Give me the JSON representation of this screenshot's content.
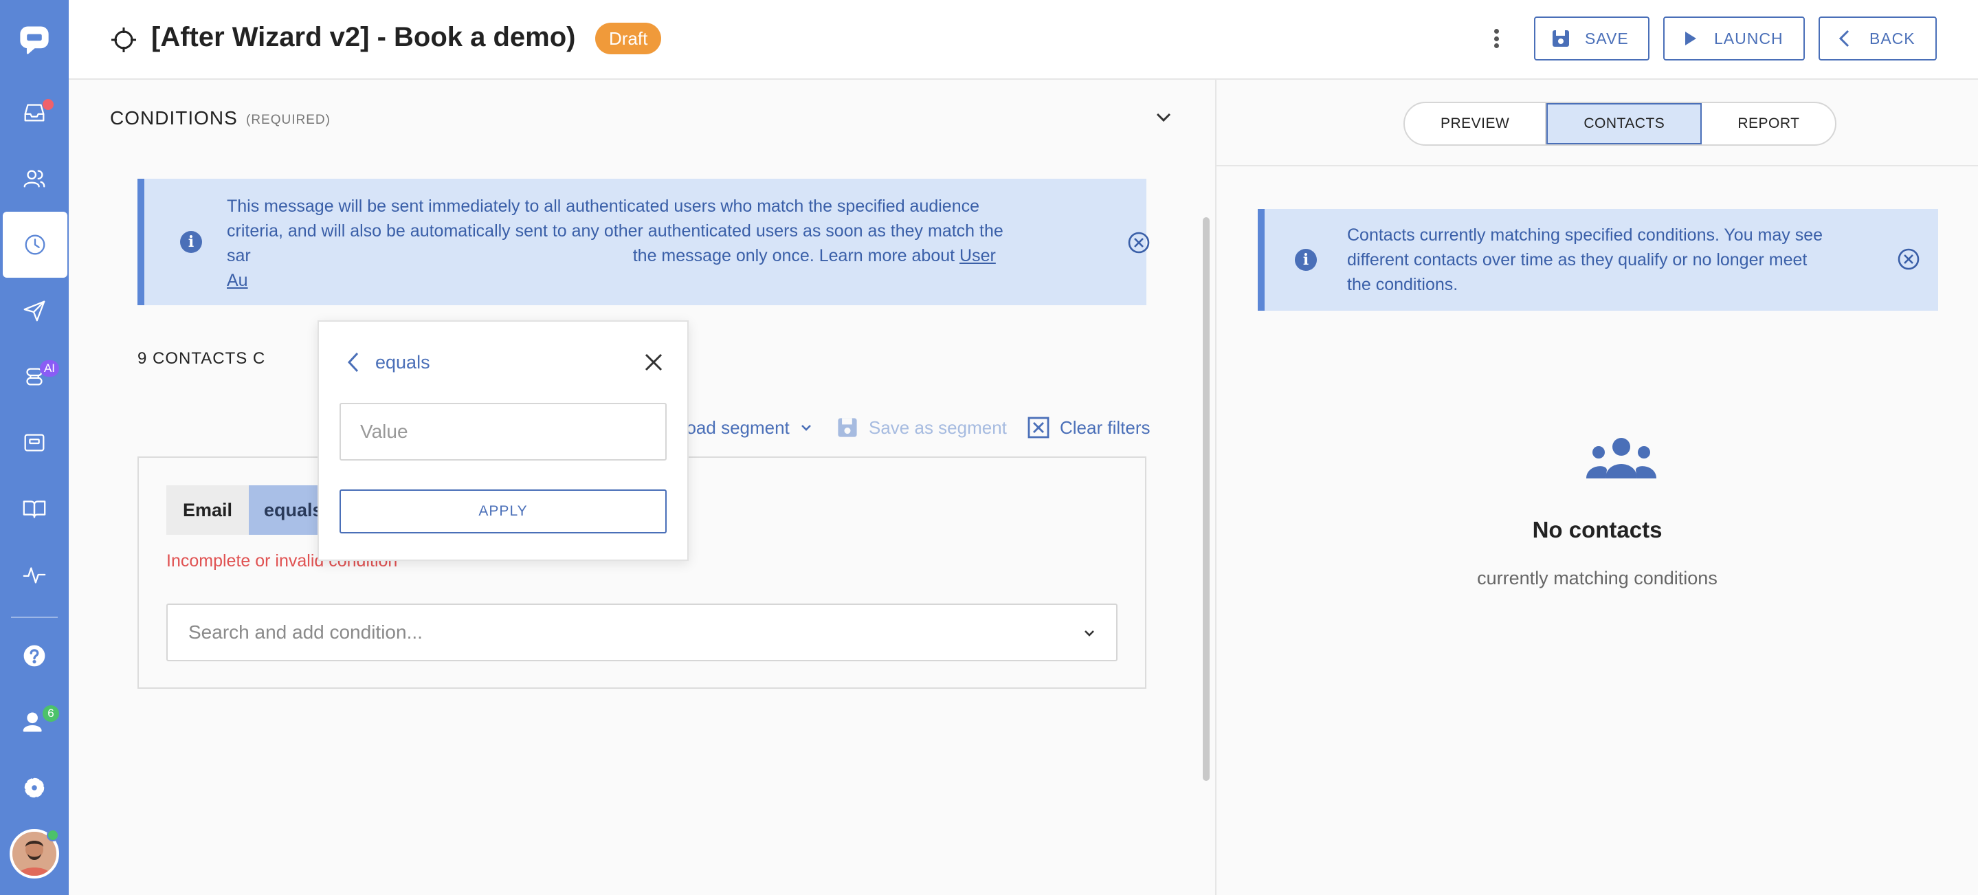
{
  "header": {
    "title": "[After Wizard v2] - Book a demo)",
    "status_badge": "Draft",
    "save_label": "SAVE",
    "launch_label": "LAUNCH",
    "back_label": "BACK"
  },
  "conditions": {
    "title": "CONDITIONS",
    "required": "(REQUIRED)",
    "info_line1": "This message will be sent immediately to all authenticated users who match the specified audience",
    "info_line2": "criteria, and will also be automatically sent to any other authenticated users as soon as they match the",
    "info_line3_start": "sar",
    "info_line3_end": "the message only once. Learn more about ",
    "info_link_1": "User",
    "info_link_2": "Au",
    "contacts_count": "9 CONTACTS C",
    "toolbar": {
      "load_segment": "Load segment",
      "save_segment": "Save as segment",
      "clear_filters": "Clear filters"
    },
    "chip_field": "Email",
    "chip_operator": "equals",
    "error_text": "Incomplete or invalid condition",
    "search_placeholder": "Search and add condition..."
  },
  "popover": {
    "operator": "equals",
    "value_placeholder": "Value",
    "apply_label": "APPLY"
  },
  "right_panel": {
    "tabs": [
      "PREVIEW",
      "CONTACTS",
      "REPORT"
    ],
    "active_tab": "CONTACTS",
    "info_text_1": "Contacts currently matching specified conditions. You may see",
    "info_text_2": "different contacts over time as they qualify or no longer meet",
    "info_text_3": "the conditions.",
    "empty_title": "No contacts",
    "empty_subtitle": "currently matching conditions"
  },
  "sidebar": {
    "ai_badge": "AI",
    "team_badge": "6"
  },
  "colors": {
    "sidebar": "#5b86d6",
    "accent": "#4a6fb8",
    "draft": "#f09a3a",
    "error": "#e05252",
    "info_bg": "#d7e4f8"
  }
}
